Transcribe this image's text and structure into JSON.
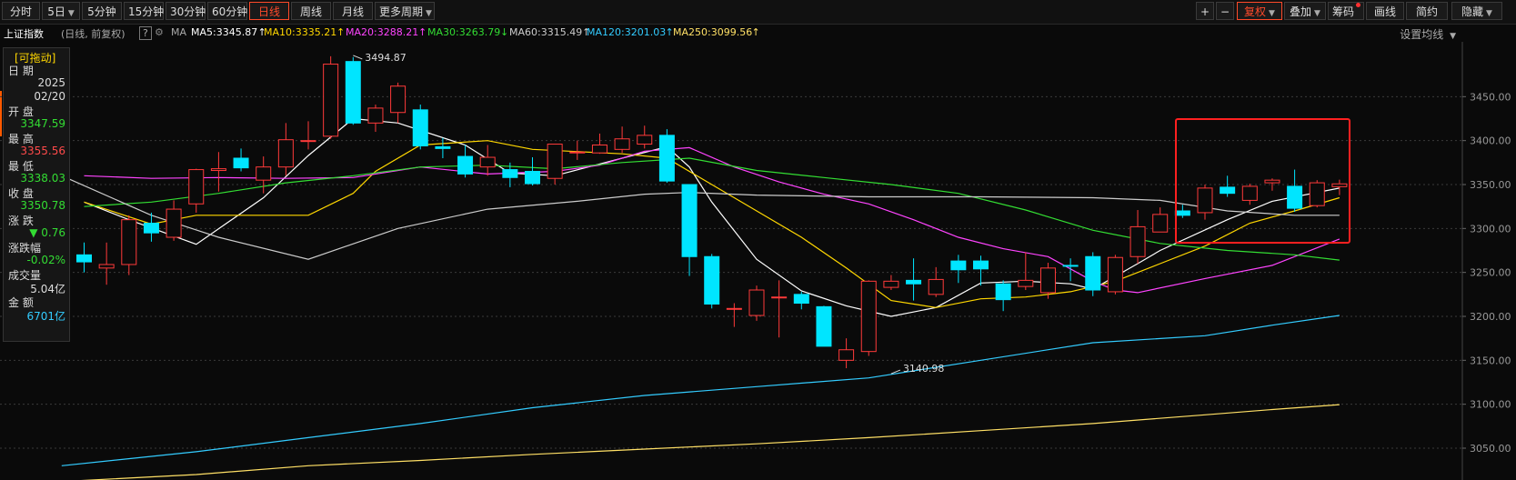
{
  "toolbar": {
    "left": [
      {
        "label": "分时",
        "active": false
      },
      {
        "label": "5日",
        "active": false,
        "caret": true
      },
      {
        "label": "5分钟",
        "active": false
      },
      {
        "label": "15分钟",
        "active": false
      },
      {
        "label": "30分钟",
        "active": false
      },
      {
        "label": "60分钟",
        "active": false
      },
      {
        "label": "日线",
        "active": true
      },
      {
        "label": "周线",
        "active": false
      },
      {
        "label": "月线",
        "active": false
      },
      {
        "label": "更多周期",
        "active": false,
        "caret": true
      }
    ],
    "zoom_in": "+",
    "zoom_out": "−",
    "right": [
      {
        "label": "复权",
        "active": true,
        "caret": true
      },
      {
        "label": "叠加",
        "active": false,
        "caret": true
      },
      {
        "label": "筹码",
        "active": false,
        "dot": true
      },
      {
        "label": "画线",
        "active": false
      },
      {
        "label": "简约",
        "active": false
      },
      {
        "label": "隐藏",
        "active": false,
        "caret": true
      }
    ]
  },
  "ma_bar": {
    "index_name": "上证指数",
    "mode": "(日线, 前复权)",
    "help": "?",
    "ma_label": "MA",
    "items": [
      {
        "text": "MA5:3345.87",
        "arrow": "↑",
        "color": "#ffffff"
      },
      {
        "text": "MA10:3335.21",
        "arrow": "↑",
        "color": "#ffd700"
      },
      {
        "text": "MA20:3288.21",
        "arrow": "↑",
        "color": "#ff44ff"
      },
      {
        "text": "MA30:3263.79",
        "arrow": "↓",
        "color": "#33dd33"
      },
      {
        "text": "MA60:3315.49",
        "arrow": "↑",
        "color": "#cccccc"
      },
      {
        "text": "MA120:3201.03",
        "arrow": "↑",
        "color": "#33ccff"
      },
      {
        "text": "MA250:3099.56",
        "arrow": "↑",
        "color": "#ffe066"
      }
    ],
    "settings_label": "设置均线"
  },
  "info_panel": {
    "title": "[可拖动]",
    "date_label": "日 期",
    "date_year": "2025",
    "date_md": "02/20",
    "open_label": "开 盘",
    "open": "3347.59",
    "high_label": "最 高",
    "high": "3355.56",
    "low_label": "最 低",
    "low": "3338.03",
    "close_label": "收 盘",
    "close": "3350.78",
    "chg_label": "涨 跌",
    "chg": "▼ 0.76",
    "pct_label": "涨跌幅",
    "pct": "-0.02%",
    "vol_label": "成交量",
    "vol": "5.04亿",
    "amt_label": "金 额",
    "amt": "6701亿"
  },
  "colors": {
    "up": "#ff3a3a",
    "down": "#00e5ff",
    "highlight": "#ff2020"
  },
  "chart_data": {
    "type": "candlestick",
    "ylim": [
      3020,
      3500
    ],
    "ticks": [
      3050,
      3100,
      3150,
      3200,
      3250,
      3300,
      3350,
      3400,
      3450
    ],
    "annotations": [
      {
        "text": "3494.87",
        "index": 12,
        "value": 3494.87
      },
      {
        "text": "3140.98",
        "index": 36,
        "value": 3140.98
      }
    ],
    "candles": [
      [
        3270,
        3262,
        3284,
        3250
      ],
      [
        3255,
        3259,
        3284,
        3236
      ],
      [
        3259,
        3310,
        3315,
        3247
      ],
      [
        3306,
        3295,
        3318,
        3285
      ],
      [
        3290,
        3322,
        3332,
        3286
      ],
      [
        3328,
        3367,
        3368,
        3318
      ],
      [
        3366,
        3368,
        3387,
        3342
      ],
      [
        3380,
        3369,
        3391,
        3365
      ],
      [
        3355,
        3370,
        3382,
        3340
      ],
      [
        3370,
        3401,
        3420,
        3360
      ],
      [
        3400,
        3400,
        3422,
        3390
      ],
      [
        3405,
        3487,
        3496,
        3402
      ],
      [
        3490,
        3420,
        3495,
        3418
      ],
      [
        3420,
        3437,
        3441,
        3410
      ],
      [
        3432,
        3462,
        3466,
        3420
      ],
      [
        3435,
        3394,
        3441,
        3390
      ],
      [
        3393,
        3391,
        3403,
        3380
      ],
      [
        3382,
        3362,
        3395,
        3358
      ],
      [
        3370,
        3381,
        3395,
        3360
      ],
      [
        3367,
        3358,
        3375,
        3347
      ],
      [
        3365,
        3351,
        3381,
        3349
      ],
      [
        3357,
        3396,
        3396,
        3350
      ],
      [
        3386,
        3387,
        3400,
        3378
      ],
      [
        3386,
        3395,
        3408,
        3385
      ],
      [
        3390,
        3402,
        3416,
        3386
      ],
      [
        3396,
        3406,
        3417,
        3391
      ],
      [
        3406,
        3354,
        3413,
        3352
      ],
      [
        3350,
        3268,
        3350,
        3246
      ],
      [
        3268,
        3214,
        3271,
        3209
      ],
      [
        3209,
        3209,
        3215,
        3188
      ],
      [
        3201,
        3230,
        3235,
        3195
      ],
      [
        3222,
        3222,
        3241,
        3176
      ],
      [
        3225,
        3215,
        3228,
        3208
      ],
      [
        3211,
        3166,
        3212,
        3166
      ],
      [
        3150,
        3162,
        3175,
        3141
      ],
      [
        3160,
        3240,
        3241,
        3155
      ],
      [
        3233,
        3240,
        3247,
        3230
      ],
      [
        3241,
        3237,
        3266,
        3218
      ],
      [
        3225,
        3242,
        3256,
        3222
      ],
      [
        3263,
        3253,
        3270,
        3238
      ],
      [
        3263,
        3254,
        3269,
        3235
      ],
      [
        3237,
        3219,
        3241,
        3206
      ],
      [
        3234,
        3241,
        3273,
        3230
      ],
      [
        3227,
        3255,
        3261,
        3220
      ],
      [
        3258,
        3257,
        3266,
        3240
      ],
      [
        3268,
        3230,
        3273,
        3223
      ],
      [
        3228,
        3267,
        3270,
        3225
      ],
      [
        3268,
        3302,
        3321,
        3260
      ],
      [
        3296,
        3316,
        3324,
        3297
      ],
      [
        3320,
        3315,
        3327,
        3312
      ],
      [
        3318,
        3346,
        3350,
        3310
      ],
      [
        3347,
        3340,
        3360,
        3336
      ],
      [
        3332,
        3348,
        3351,
        3327
      ],
      [
        3352,
        3355,
        3357,
        3343
      ],
      [
        3348,
        3323,
        3367,
        3319
      ],
      [
        3326,
        3352,
        3355,
        3324
      ],
      [
        3347.59,
        3350.78,
        3355.56,
        3338.03
      ]
    ],
    "ma_lines": [
      {
        "name": "MA5",
        "color": "#ffffff",
        "points": [
          [
            0,
            3330
          ],
          [
            2,
            3310
          ],
          [
            5,
            3282
          ],
          [
            8,
            3335
          ],
          [
            10,
            3383
          ],
          [
            12,
            3425
          ],
          [
            14,
            3420
          ],
          [
            17,
            3395
          ],
          [
            19,
            3363
          ],
          [
            21,
            3360
          ],
          [
            24,
            3380
          ],
          [
            26,
            3393
          ],
          [
            27,
            3370
          ],
          [
            28,
            3330
          ],
          [
            30,
            3265
          ],
          [
            32,
            3229
          ],
          [
            34,
            3212
          ],
          [
            36,
            3200
          ],
          [
            38,
            3210
          ],
          [
            40,
            3238
          ],
          [
            42,
            3240
          ],
          [
            44,
            3237
          ],
          [
            45,
            3231
          ],
          [
            47,
            3260
          ],
          [
            48,
            3275
          ],
          [
            51,
            3310
          ],
          [
            53,
            3331
          ],
          [
            56,
            3346
          ]
        ]
      },
      {
        "name": "MA10",
        "color": "#ffd700",
        "points": [
          [
            0,
            3330
          ],
          [
            3,
            3305
          ],
          [
            5,
            3315
          ],
          [
            10,
            3315
          ],
          [
            12,
            3340
          ],
          [
            13,
            3365
          ],
          [
            15,
            3395
          ],
          [
            18,
            3400
          ],
          [
            20,
            3390
          ],
          [
            24,
            3385
          ],
          [
            26,
            3380
          ],
          [
            28,
            3350
          ],
          [
            30,
            3320
          ],
          [
            32,
            3290
          ],
          [
            34,
            3255
          ],
          [
            36,
            3218
          ],
          [
            38,
            3210
          ],
          [
            40,
            3220
          ],
          [
            42,
            3222
          ],
          [
            44,
            3228
          ],
          [
            46,
            3240
          ],
          [
            48,
            3260
          ],
          [
            50,
            3280
          ],
          [
            52,
            3306
          ],
          [
            54,
            3320
          ],
          [
            56,
            3335
          ]
        ]
      },
      {
        "name": "MA20",
        "color": "#ff44ff",
        "points": [
          [
            0,
            3360
          ],
          [
            3,
            3357
          ],
          [
            6,
            3358
          ],
          [
            9,
            3357
          ],
          [
            12,
            3358
          ],
          [
            15,
            3370
          ],
          [
            18,
            3362
          ],
          [
            21,
            3365
          ],
          [
            23,
            3372
          ],
          [
            25,
            3388
          ],
          [
            27,
            3392
          ],
          [
            29,
            3370
          ],
          [
            31,
            3353
          ],
          [
            33,
            3339
          ],
          [
            35,
            3328
          ],
          [
            37,
            3310
          ],
          [
            39,
            3290
          ],
          [
            41,
            3277
          ],
          [
            43,
            3268
          ],
          [
            45,
            3240
          ],
          [
            46,
            3230
          ],
          [
            47,
            3227
          ],
          [
            50,
            3243
          ],
          [
            53,
            3258
          ],
          [
            56,
            3288
          ]
        ]
      },
      {
        "name": "MA30",
        "color": "#33dd33",
        "points": [
          [
            0,
            3325
          ],
          [
            3,
            3330
          ],
          [
            6,
            3340
          ],
          [
            9,
            3352
          ],
          [
            12,
            3360
          ],
          [
            15,
            3370
          ],
          [
            18,
            3372
          ],
          [
            21,
            3368
          ],
          [
            24,
            3375
          ],
          [
            27,
            3380
          ],
          [
            30,
            3366
          ],
          [
            33,
            3358
          ],
          [
            36,
            3350
          ],
          [
            39,
            3340
          ],
          [
            42,
            3321
          ],
          [
            45,
            3298
          ],
          [
            48,
            3283
          ],
          [
            51,
            3275
          ],
          [
            54,
            3270
          ],
          [
            56,
            3264
          ]
        ]
      },
      {
        "name": "MA60",
        "color": "#cccccc",
        "points": [
          [
            -1,
            3360
          ],
          [
            3,
            3315
          ],
          [
            6,
            3290
          ],
          [
            10,
            3265
          ],
          [
            14,
            3300
          ],
          [
            18,
            3322
          ],
          [
            22,
            3331
          ],
          [
            25,
            3339
          ],
          [
            27,
            3341
          ],
          [
            30,
            3338
          ],
          [
            35,
            3336
          ],
          [
            40,
            3336
          ],
          [
            45,
            3335
          ],
          [
            48,
            3332
          ],
          [
            51,
            3320
          ],
          [
            54,
            3315
          ],
          [
            56,
            3315
          ]
        ]
      },
      {
        "name": "MA120",
        "color": "#33ccff",
        "points": [
          [
            -1,
            3030
          ],
          [
            5,
            3046
          ],
          [
            10,
            3062
          ],
          [
            15,
            3078
          ],
          [
            20,
            3096
          ],
          [
            25,
            3110
          ],
          [
            30,
            3120
          ],
          [
            35,
            3130
          ],
          [
            40,
            3150
          ],
          [
            45,
            3170
          ],
          [
            50,
            3178
          ],
          [
            53,
            3190
          ],
          [
            56,
            3201
          ]
        ]
      },
      {
        "name": "MA250",
        "color": "#ffe066",
        "points": [
          [
            -1,
            3012
          ],
          [
            5,
            3020
          ],
          [
            10,
            3030
          ],
          [
            15,
            3036
          ],
          [
            20,
            3043
          ],
          [
            25,
            3049
          ],
          [
            30,
            3055
          ],
          [
            35,
            3062
          ],
          [
            40,
            3070
          ],
          [
            45,
            3078
          ],
          [
            50,
            3088
          ],
          [
            53,
            3094
          ],
          [
            56,
            3099.56
          ]
        ]
      }
    ]
  }
}
